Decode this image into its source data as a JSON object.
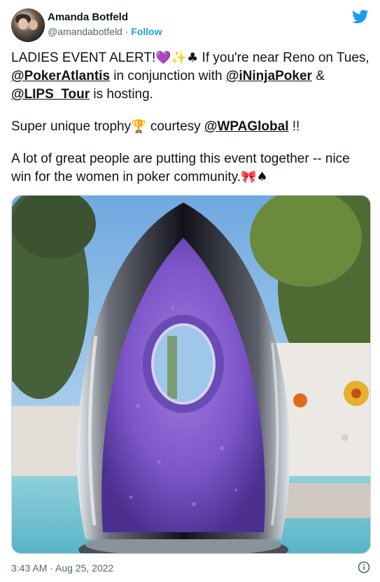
{
  "author": {
    "name": "Amanda Botfeld",
    "handle": "@amandabotfeld",
    "separator": "·",
    "follow_label": "Follow"
  },
  "tweet": {
    "p1_a": "LADIES EVENT ALERT!",
    "p1_b": " If you're near Reno on Tues, ",
    "mention_1": "@PokerAtlantis",
    "p1_c": " in conjunction with ",
    "mention_2": "@iNinjaPoker",
    "p1_d": " & ",
    "mention_3": "@LIPS_Tour",
    "p1_e": " is hosting.",
    "p2_a": "Super unique trophy",
    "p2_b": " courtesy ",
    "mention_4": "@WPAGlobal",
    "p2_c": " !!",
    "p3": "A lot of great people are putting this event together -- nice win for the women in poker community.",
    "emoji": {
      "heart": "💜",
      "sparkles": "✨",
      "club": "♣",
      "trophy": "🏆",
      "ribbon": "🎀",
      "spade": "♠"
    }
  },
  "media": {
    "icon": "glass-trophy-photo"
  },
  "footer": {
    "timestamp": "3:43 AM · Aug 25, 2022"
  },
  "icons": {
    "brand": "twitter-bird-icon",
    "info": "info-icon"
  },
  "colors": {
    "link": "#1d9bf0",
    "text": "#0f1419",
    "muted": "#536471",
    "trophy_purple": "#7a52c7"
  }
}
